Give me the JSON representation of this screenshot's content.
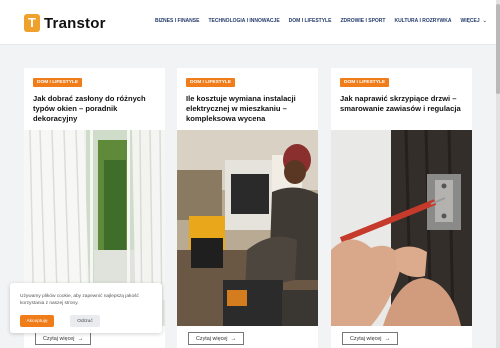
{
  "brand": {
    "mark": "T",
    "name": "Transtor",
    "color": "#f0a12b"
  },
  "nav": {
    "items": [
      "BIZNES I FINANSE",
      "TECHNOLOGIA I INNOWACJE",
      "DOM I LIFESTYLE",
      "ZDROWIE I SPORT",
      "KULTURA I ROZRYWKA"
    ],
    "more": "WIĘCEJ"
  },
  "cards": [
    {
      "category": "DOM I LIFESTYLE",
      "title": "Jak dobrać zasłony do różnych typów okien – poradnik dekoracyjny",
      "read_more": "Czytaj więcej"
    },
    {
      "category": "DOM I LIFESTYLE",
      "title": "Ile kosztuje wymiana instalacji elektrycznej w mieszkaniu – kompleksowa wycena",
      "read_more": "Czytaj więcej"
    },
    {
      "category": "DOM I LIFESTYLE",
      "title": "Jak naprawić skrzypiące drzwi – smarowanie zawiasów i regulacja",
      "read_more": "Czytaj więcej"
    }
  ],
  "cookie": {
    "text": "Używamy plików cookie, aby zapewnić najlepszą jakość korzystania z naszej strony.",
    "accept": "Akceptuję",
    "decline": "Odrzuć"
  },
  "colors": {
    "accent": "#f07c1a",
    "nav": "#243b6b"
  }
}
